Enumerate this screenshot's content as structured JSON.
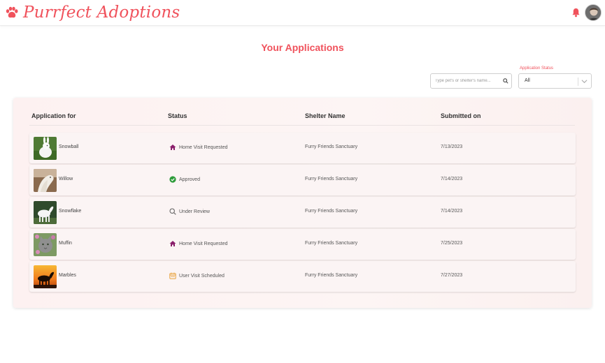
{
  "app": {
    "name": "Purrfect Adoptions",
    "brand_color": "#f0525c"
  },
  "header": {
    "notification_icon": "bell-icon",
    "avatar_icon": "user-avatar"
  },
  "page": {
    "title": "Your Applications"
  },
  "filters": {
    "search_placeholder": "Type pet's or shelter's name...",
    "search_value": "",
    "status_label": "Application Status",
    "status_value": "All"
  },
  "table": {
    "columns": [
      "Application for",
      "Status",
      "Shelter Name",
      "Submitted on"
    ],
    "rows": [
      {
        "pet": "Snowball",
        "status": "Home Visit Requested",
        "status_icon": "home-icon",
        "shelter": "Furry Friends Sanctuary",
        "submitted": "7/13/2023"
      },
      {
        "pet": "Willow",
        "status": "Approved",
        "status_icon": "check-circle-icon",
        "shelter": "Furry Friends Sanctuary",
        "submitted": "7/14/2023"
      },
      {
        "pet": "Snowflake",
        "status": "Under Review",
        "status_icon": "magnifier-icon",
        "shelter": "Furry Friends Sanctuary",
        "submitted": "7/14/2023"
      },
      {
        "pet": "Muffin",
        "status": "Home Visit Requested",
        "status_icon": "home-icon",
        "shelter": "Furry Friends Sanctuary",
        "submitted": "7/25/2023"
      },
      {
        "pet": "Marbles",
        "status": "User Visit Scheduled",
        "status_icon": "calendar-icon",
        "shelter": "Furry Friends Sanctuary",
        "submitted": "7/27/2023"
      }
    ]
  },
  "status_colors": {
    "home": "#8a1f6b",
    "approved": "#2e9b3a",
    "review": "#666666",
    "scheduled": "#e8a13a"
  }
}
